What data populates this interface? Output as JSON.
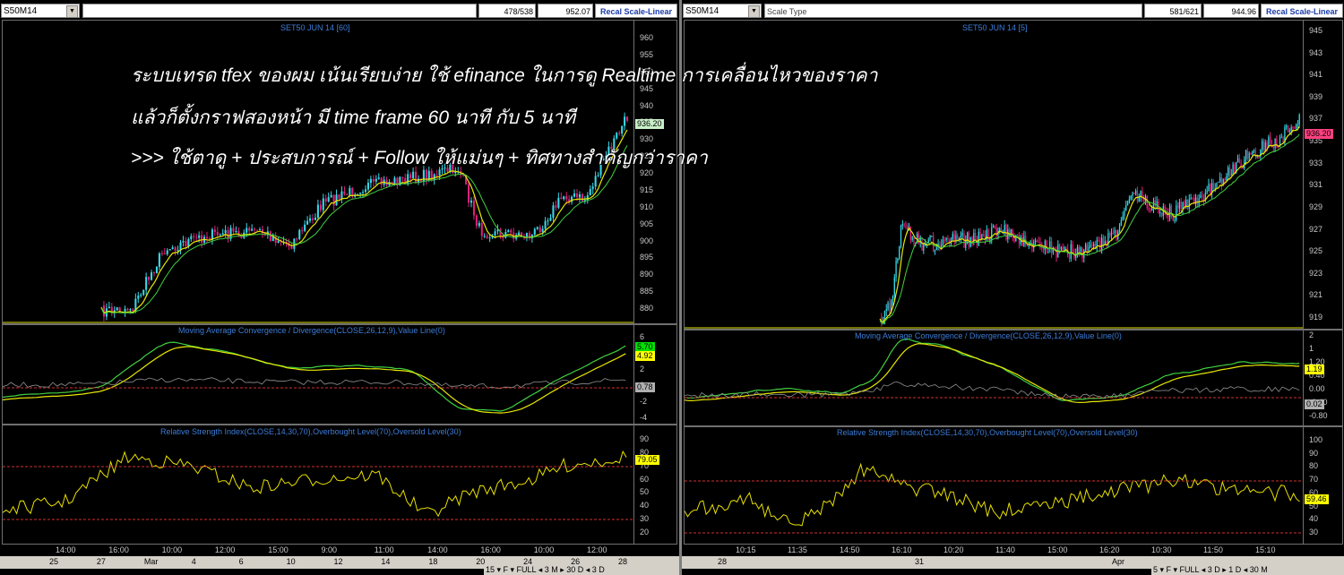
{
  "left": {
    "symbol": "S50M14",
    "count": "478/538",
    "price": "952.07",
    "recal_label": "Recal Scale-Linear",
    "price_panel": {
      "title": "SET50 JUN 14  [60]",
      "ticks": [
        "960",
        "955",
        "950",
        "945",
        "940",
        "935",
        "930",
        "925",
        "920",
        "915",
        "910",
        "905",
        "900",
        "895",
        "890",
        "885",
        "880"
      ],
      "last_price": "936.20"
    },
    "macd_panel": {
      "title": "Moving Average Convergence / Divergence(CLOSE,26,12,9),Value Line(0)",
      "ticks": [
        "6",
        "4",
        "2",
        "0",
        "-2",
        "-4"
      ],
      "badges": [
        "5.70",
        "4.92",
        "0.78"
      ]
    },
    "rsi_panel": {
      "title": "Relative Strength Index(CLOSE,14,30,70),Overbought Level(70),Oversold Level(30)",
      "ticks": [
        "90",
        "80",
        "70",
        "60",
        "50",
        "40",
        "30",
        "20"
      ],
      "badge": "79.05"
    },
    "time_ticks": [
      "14:00",
      "16:00",
      "10:00",
      "12:00",
      "15:00",
      "9:00",
      "11:00",
      "14:00",
      "16:00",
      "10:00",
      "12:00"
    ],
    "date_ticks": [
      "25",
      "27",
      "Mar",
      "4",
      "6",
      "10",
      "12",
      "14",
      "18",
      "20",
      "24",
      "26",
      "28"
    ],
    "status": "15 ▾  F  ▾  FULL ◂ 3 M ▸ 30 D ◂ 3 D"
  },
  "right": {
    "symbol": "S50M14",
    "scale_type": "Scale Type",
    "count": "581/621",
    "price": "944.96",
    "recal_label": "Recal Scale-Linear",
    "price_panel": {
      "title": "SET50 JUN 14  [5]",
      "ticks": [
        "945",
        "943",
        "941",
        "939",
        "937",
        "935",
        "933",
        "931",
        "929",
        "927",
        "925",
        "923",
        "921",
        "919"
      ],
      "last_price": "936.20"
    },
    "macd_panel": {
      "title": "Moving Average Convergence / Divergence(CLOSE,26,12,9),Value Line(0)",
      "ticks": [
        "2",
        "1",
        "1.20",
        "0.40",
        "0.00",
        "-0.40",
        "-0.80"
      ],
      "badges": [
        "1.19",
        "0.02"
      ]
    },
    "rsi_panel": {
      "title": "Relative Strength Index(CLOSE,14,30,70),Overbought Level(70),Oversold Level(30)",
      "ticks": [
        "100",
        "90",
        "80",
        "70",
        "60",
        "50",
        "40",
        "30"
      ],
      "badge": "59.46"
    },
    "time_ticks": [
      "10:15",
      "11:35",
      "14:50",
      "16:10",
      "10:20",
      "11:40",
      "15:00",
      "16:20",
      "10:30",
      "11:50",
      "15:10"
    ],
    "date_ticks": [
      "28",
      "31",
      "Apr"
    ],
    "status": "5 ▾  F  ▾  FULL ◂ 3 D ▸ 1 D ◂ 30 M"
  },
  "overlay_text": {
    "line1": "ระบบเทรด tfex ของผม เน้นเรียบง่าย ใช้ efinance ในการดู Realtime การเคลื่อนไหวของราคา",
    "line2": "แล้วก็ตั้งกราฟสองหน้า มี time frame 60 นาที กับ 5 นาที",
    "line3": ">>>  ใช้ตาดู + ประสบการณ์ + Follow ให้แม่นๆ + ทิศทางสำคัญกว่าราคา"
  },
  "colors": {
    "up_candle": "#38d8e8",
    "down_candle": "#e0207a",
    "ma_fast": "#e8e800",
    "ma_slow": "#40d040",
    "rsi_line": "#e8e000",
    "level_line": "#d03030",
    "title_blue": "#3c7cd8",
    "badge_green": "#00e000",
    "badge_yellow": "#ffff00",
    "badge_gray": "#b0b0b0",
    "badge_pink": "#ff4080"
  }
}
